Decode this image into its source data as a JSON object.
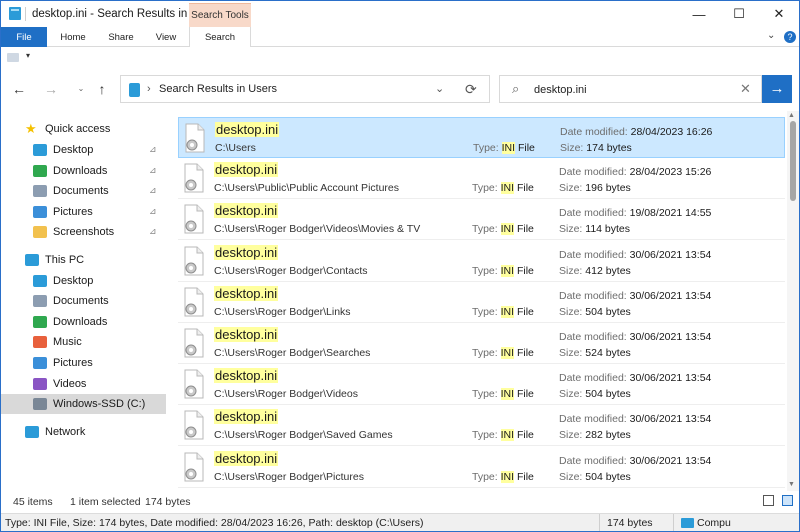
{
  "window": {
    "title": "desktop.ini - Search Results in Users",
    "context_tab": "Search Tools",
    "controls": {
      "minimize": "—",
      "maximize": "☐",
      "close": "✕"
    }
  },
  "ribbon": {
    "tabs": [
      "File",
      "Home",
      "Share",
      "View",
      "Search"
    ],
    "expand_glyph": "⌄",
    "help_glyph": "?"
  },
  "navbar": {
    "back_glyph": "←",
    "forward_glyph": "→",
    "recent_glyph": "⌄",
    "up_glyph": "↑",
    "address": "Search Results in Users",
    "address_chevron": "›",
    "address_dropdown": "⌄",
    "refresh_glyph": "⟳",
    "search_value": "desktop.ini",
    "search_glyph": "⌕",
    "clear_glyph": "✕",
    "go_glyph": "→"
  },
  "sidebar": {
    "pin_glyph": "📌",
    "items": [
      {
        "label": "Quick access",
        "icon": "star-icon",
        "color": "#f5c100",
        "indent": 0,
        "expander": ""
      },
      {
        "label": "Desktop",
        "icon": "desktop-folder-icon",
        "color": "#2b9bd8",
        "indent": 1,
        "pinned": true
      },
      {
        "label": "Downloads",
        "icon": "download-icon",
        "color": "#2fa84f",
        "indent": 1,
        "pinned": true
      },
      {
        "label": "Documents",
        "icon": "documents-icon",
        "color": "#8c9db1",
        "indent": 1,
        "pinned": true
      },
      {
        "label": "Pictures",
        "icon": "pictures-icon",
        "color": "#3b8fd9",
        "indent": 1,
        "pinned": true
      },
      {
        "label": "Screenshots",
        "icon": "folder-icon",
        "color": "#f2c14e",
        "indent": 1,
        "pinned": true
      },
      {
        "label": "This PC",
        "icon": "pc-icon",
        "color": "#2b9bd8",
        "indent": 0
      },
      {
        "label": "Desktop",
        "icon": "desktop-folder-icon",
        "color": "#2b9bd8",
        "indent": 1
      },
      {
        "label": "Documents",
        "icon": "documents-icon",
        "color": "#8c9db1",
        "indent": 1
      },
      {
        "label": "Downloads",
        "icon": "download-icon",
        "color": "#2fa84f",
        "indent": 1
      },
      {
        "label": "Music",
        "icon": "music-icon",
        "color": "#e8603c",
        "indent": 1
      },
      {
        "label": "Pictures",
        "icon": "pictures-icon",
        "color": "#3b8fd9",
        "indent": 1
      },
      {
        "label": "Videos",
        "icon": "videos-icon",
        "color": "#8a55c4",
        "indent": 1
      },
      {
        "label": "Windows-SSD (C:)",
        "icon": "drive-icon",
        "color": "#7a8796",
        "indent": 1,
        "selected": true
      },
      {
        "label": "Network",
        "icon": "network-icon",
        "color": "#2b9bd8",
        "indent": 0
      }
    ]
  },
  "results": {
    "type_prefix": "Type: ",
    "type_hl": "INI",
    "type_tail": " File",
    "date_prefix": "Date modified: ",
    "size_prefix": "Size: ",
    "rows": [
      {
        "name": "desktop.ini",
        "path": "C:\\Users",
        "date": "28/04/2023 16:26",
        "size": "174 bytes",
        "selected": true
      },
      {
        "name": "desktop.ini",
        "path": "C:\\Users\\Public\\Public Account Pictures",
        "date": "28/04/2023 15:26",
        "size": "196 bytes"
      },
      {
        "name": "desktop.ini",
        "path": "C:\\Users\\Roger Bodger\\Videos\\Movies & TV",
        "date": "19/08/2021 14:55",
        "size": "114 bytes"
      },
      {
        "name": "desktop.ini",
        "path": "C:\\Users\\Roger Bodger\\Contacts",
        "date": "30/06/2021 13:54",
        "size": "412 bytes"
      },
      {
        "name": "desktop.ini",
        "path": "C:\\Users\\Roger Bodger\\Links",
        "date": "30/06/2021 13:54",
        "size": "504 bytes"
      },
      {
        "name": "desktop.ini",
        "path": "C:\\Users\\Roger Bodger\\Searches",
        "date": "30/06/2021 13:54",
        "size": "524 bytes"
      },
      {
        "name": "desktop.ini",
        "path": "C:\\Users\\Roger Bodger\\Videos",
        "date": "30/06/2021 13:54",
        "size": "504 bytes"
      },
      {
        "name": "desktop.ini",
        "path": "C:\\Users\\Roger Bodger\\Saved Games",
        "date": "30/06/2021 13:54",
        "size": "282 bytes"
      },
      {
        "name": "desktop.ini",
        "path": "C:\\Users\\Roger Bodger\\Pictures",
        "date": "30/06/2021 13:54",
        "size": "504 bytes"
      }
    ]
  },
  "statusbar": {
    "items": "45 items",
    "selected": "1 item selected",
    "size": "174 bytes"
  },
  "detailbar": {
    "text": "Type: INI File, Size: 174 bytes, Date modified: 28/04/2023 16:26, Path: desktop (C:\\Users)",
    "size": "174 bytes",
    "location": "Compu"
  },
  "colors": {
    "accent": "#1f6fc5",
    "selection": "#cce8ff",
    "highlight": "#ffff9e",
    "context_tab": "#f8d9c9"
  }
}
